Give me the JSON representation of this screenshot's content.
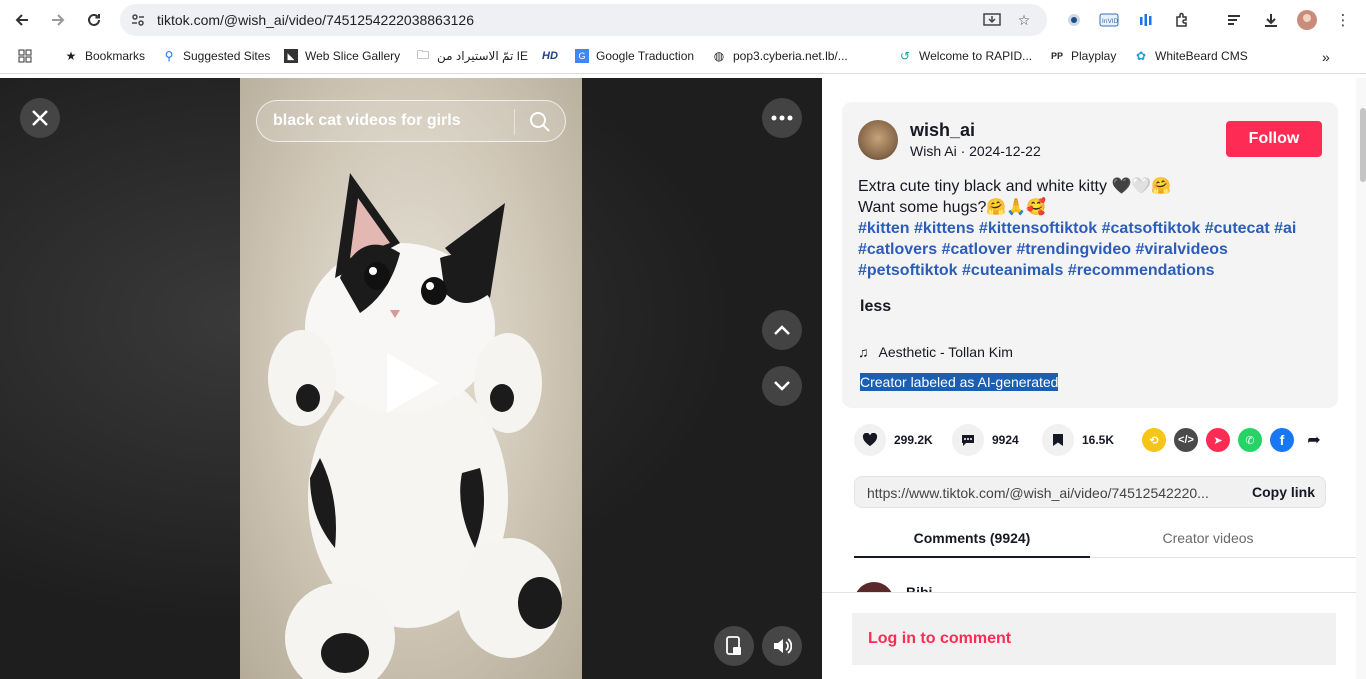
{
  "browser": {
    "url": "tiktok.com/@wish_ai/video/7451254222038863126",
    "bookmarks": [
      {
        "label": "Bookmarks",
        "icon": "star-icon"
      },
      {
        "label": "Suggested Sites",
        "icon": "search-icon"
      },
      {
        "label": "Web Slice Gallery",
        "icon": "web-slice-icon"
      },
      {
        "label": "تمّ الاستيراد من IE",
        "icon": "folder-icon"
      },
      {
        "label": "HD",
        "icon": "hd-icon"
      },
      {
        "label": "Google Traduction",
        "icon": "translate-icon"
      },
      {
        "label": "pop3.cyberia.net.lb/...",
        "icon": "globe-icon"
      },
      {
        "label": "Welcome to RAPID...",
        "icon": "rapid-icon"
      },
      {
        "label": "Playplay",
        "icon": "playplay-icon"
      },
      {
        "label": "WhiteBeard CMS",
        "icon": "whitebeard-icon"
      }
    ]
  },
  "video": {
    "search_text": "black cat videos for girls"
  },
  "post": {
    "username": "wish_ai",
    "subtitle": "Wish Ai · 2024-12-22",
    "follow_label": "Follow",
    "desc_line1": "Extra cute tiny black and white kitty 🖤🤍🤗",
    "desc_line2": "Want some hugs?🤗🙏🥰",
    "hashtags": "#kitten #kittens #kittensoftiktok #catsoftiktok #cutecat #ai #catlovers #catlover #trendingvideo #viralvideos #petsoftiktok #cuteanimals #recommendations",
    "less_label": "less",
    "music": "Aesthetic - Tollan Kim",
    "ai_label": "Creator labeled as AI-generated"
  },
  "actions": {
    "likes": "299.2K",
    "comments": "9924",
    "saves": "16.5K"
  },
  "share_colors": {
    "repost": "#f5c518",
    "embed": "#4a4a4a",
    "send": "#fe2c55",
    "whatsapp": "#25d366",
    "facebook": "#1877f2"
  },
  "link": {
    "url": "https://www.tiktok.com/@wish_ai/video/74512542220...",
    "copy_label": "Copy link"
  },
  "tabs": {
    "comments": "Comments (9924)",
    "creator": "Creator videos"
  },
  "comment_peek": {
    "name": "Bibi"
  },
  "login_label": "Log in to comment"
}
